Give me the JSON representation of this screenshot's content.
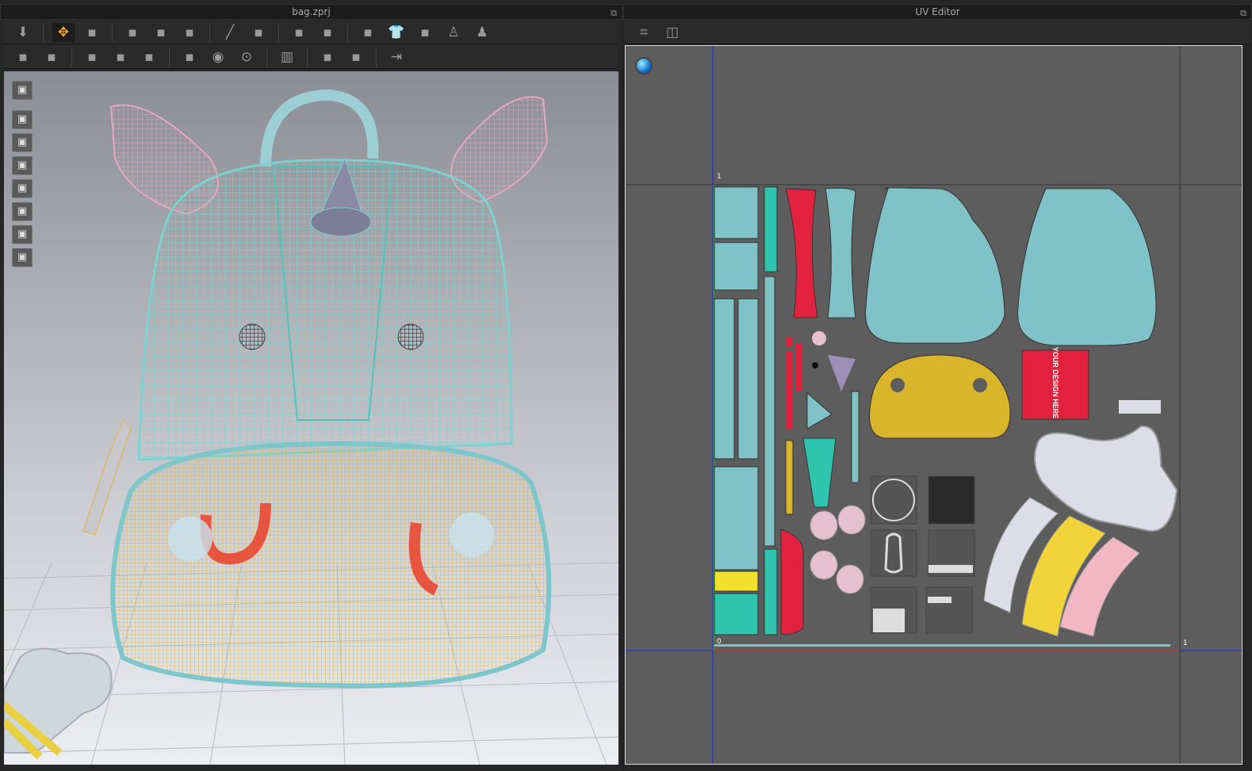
{
  "left_panel": {
    "title": "bag.zprj",
    "toolbar_row1": [
      "down-arrow-icon",
      "select-move-icon",
      "edit-pattern-icon",
      "segment-sewing-icon",
      "free-sewing-icon",
      "curve-sewing-icon",
      "pin-icon",
      "tack-icon",
      "trace-curve-icon",
      "trace-mesh-icon",
      "show-3d-garment-icon",
      "garment-icon",
      "fold-icon",
      "avatar-icon",
      "avatar-skeleton-icon"
    ],
    "toolbar_row2": [
      "select-mesh-icon",
      "edit-mesh-icon",
      "texture-transform-icon",
      "graphic-icon",
      "pattern-graphic-icon",
      "select-button-icon",
      "button-icon",
      "buttonhole-icon",
      "zipper-icon",
      "topstitch-icon",
      "piping-icon",
      "fold-arrange-icon"
    ],
    "side_tools": [
      "render-icon",
      "show-garment-icon",
      "show-points-icon",
      "show-avatar-icon",
      "show-mesh-icon",
      "show-surface-icon",
      "avatar-view-icon",
      "visibility-icon"
    ]
  },
  "right_panel": {
    "title": "UV Editor",
    "toolbar": [
      "snapshot-uv-icon",
      "snapshot-texture-icon"
    ],
    "axis_labels": {
      "v_top": "1",
      "origin": "0",
      "u_right": "1"
    },
    "design_label": "YOUR DESIGN HERE"
  },
  "colors": {
    "teal": "#7fc3c9",
    "red": "#e2213f",
    "yellow": "#d8b52a",
    "lilac": "#dcdde8",
    "pink": "#f2b6c5"
  }
}
